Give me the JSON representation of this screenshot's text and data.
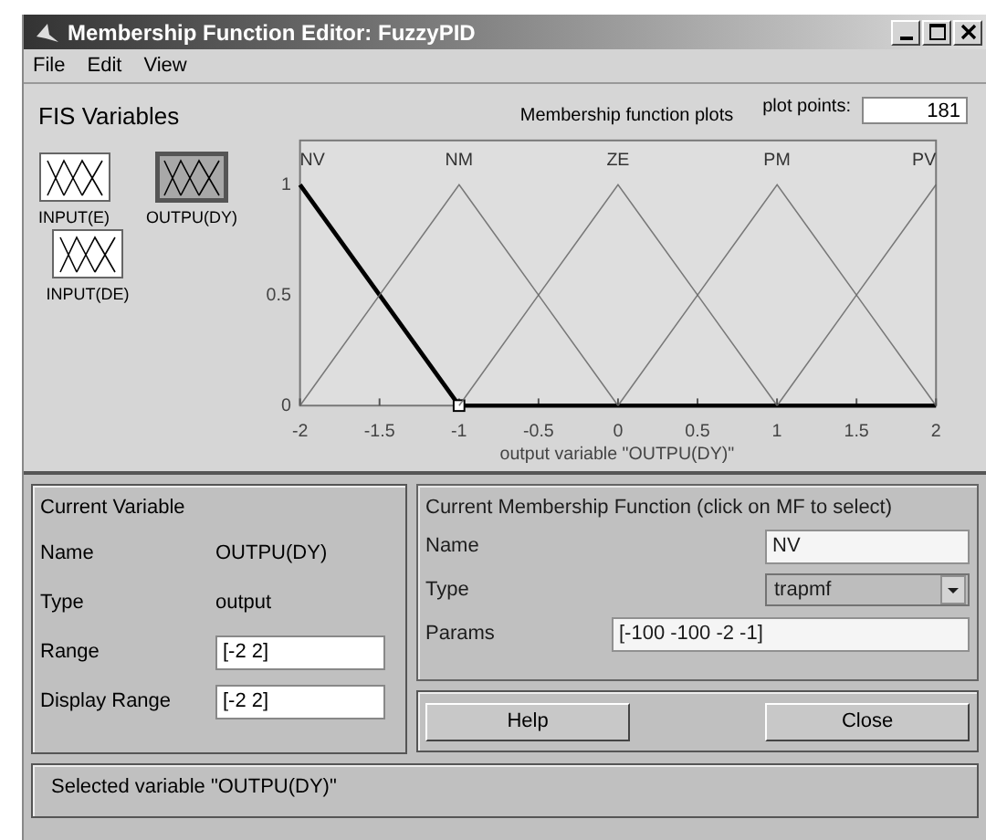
{
  "window": {
    "title": "Membership Function Editor: FuzzyPID"
  },
  "menu": [
    "File",
    "Edit",
    "View"
  ],
  "fis_variables": {
    "title": "FIS Variables",
    "items": [
      {
        "name": "INPUT(E)",
        "selected": false
      },
      {
        "name": "OUTPU(DY)",
        "selected": true
      },
      {
        "name": "INPUT(DE)",
        "selected": false
      }
    ]
  },
  "plot": {
    "title": "Membership function plots",
    "plot_points_label": "plot points:",
    "plot_points": "181",
    "membership_functions": [
      {
        "selected": true
      },
      {
        "selected": false
      },
      {
        "selected": false
      },
      {
        "selected": false
      },
      {
        "selected": false
      }
    ],
    "chart_data": {
      "type": "line",
      "xlabel": "output variable \"OUTPU(DY)\"",
      "x": [
        -2,
        -1.5,
        -1,
        -0.5,
        0,
        0.5,
        1,
        1.5,
        2
      ],
      "xlim": [
        -2,
        2
      ],
      "ylim": [
        0,
        1.2
      ],
      "xticks": [
        -2,
        -1.5,
        -1,
        -0.5,
        0,
        0.5,
        1,
        1.5,
        2
      ],
      "yticks": [
        0,
        0.5,
        1
      ],
      "series": [
        {
          "name": "NV",
          "color": "#000000",
          "values": [
            1,
            0.5,
            0,
            0,
            0,
            0,
            0,
            0,
            0
          ]
        },
        {
          "name": "NM",
          "color": "#666666",
          "values": [
            0,
            0.5,
            1,
            0.5,
            0,
            null,
            null,
            null,
            null
          ]
        },
        {
          "name": "ZE",
          "color": "#666666",
          "values": [
            null,
            null,
            0,
            0.5,
            1,
            0.5,
            0,
            null,
            null
          ]
        },
        {
          "name": "PM",
          "color": "#666666",
          "values": [
            null,
            null,
            null,
            null,
            0,
            0.5,
            1,
            0.5,
            0
          ]
        },
        {
          "name": "PV",
          "color": "#666666",
          "values": [
            null,
            null,
            null,
            null,
            null,
            null,
            0,
            0.5,
            1
          ]
        }
      ]
    }
  },
  "current_variable": {
    "title": "Current Variable",
    "name_label": "Name",
    "name": "OUTPU(DY)",
    "type_label": "Type",
    "type": "output",
    "range_label": "Range",
    "range": "[-2 2]",
    "display_range_label": "Display Range",
    "display_range": "[-2 2]"
  },
  "current_mf": {
    "title": "Current Membership Function (click on MF to select)",
    "name_label": "Name",
    "name": "NV",
    "type_label": "Type",
    "type": "trapmf",
    "params_label": "Params",
    "params": "[-100 -100 -2 -1]"
  },
  "buttons": [
    "Help",
    "Close"
  ],
  "status": "Selected variable \"OUTPU(DY)\""
}
